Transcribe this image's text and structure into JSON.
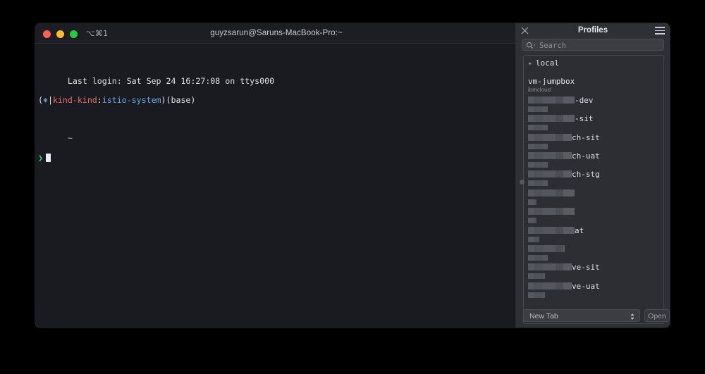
{
  "window": {
    "title": "guyzsarun@Saruns-MacBook-Pro:~",
    "shortcut": "⌥⌘1",
    "controls": {
      "close": "close-button",
      "minimize": "minimize-button",
      "maximize": "maximize-button"
    }
  },
  "terminal": {
    "last_login": "Last login: Sat Sep 24 16:27:08 on ttys000",
    "prompt_context": {
      "open_paren": "(",
      "helm_glyph": "⎈",
      "pipe": "|",
      "cluster": "kind-kind",
      "colon": ":",
      "namespace": "istio-system",
      "close_paren": ")",
      "conda_env": "(base)"
    },
    "cwd": "~",
    "prompt_char": "❯",
    "command": ""
  },
  "profiles_panel": {
    "title": "Profiles",
    "close_icon": "close-icon",
    "menu_icon": "hamburger-icon",
    "search": {
      "placeholder": "Search",
      "value": "",
      "icon": "search-icon"
    },
    "items": [
      {
        "name": "local",
        "starred": true,
        "star": "✶",
        "subtitle": "",
        "redacted": false
      },
      {
        "name": "vm-jumpbox",
        "starred": false,
        "subtitle": "ibmcloud",
        "redacted": false
      },
      {
        "name": "-dev",
        "starred": false,
        "subtitle": "",
        "redacted": true,
        "redact_width": 66,
        "sub_redact_width": 28
      },
      {
        "name": "-sit",
        "starred": false,
        "subtitle": "",
        "redacted": true,
        "redact_width": 66,
        "sub_redact_width": 28
      },
      {
        "name": "ch-sit",
        "starred": false,
        "subtitle": "",
        "redacted": true,
        "redact_width": 62,
        "sub_redact_width": 28
      },
      {
        "name": "ch-uat",
        "starred": false,
        "subtitle": "",
        "redacted": true,
        "redact_width": 62,
        "sub_redact_width": 28
      },
      {
        "name": "ch-stg",
        "starred": false,
        "subtitle": "",
        "redacted": true,
        "redact_width": 62,
        "sub_redact_width": 28
      },
      {
        "name": "",
        "starred": false,
        "subtitle": "",
        "redacted": true,
        "redact_width": 66,
        "sub_redact_width": 12
      },
      {
        "name": "",
        "starred": false,
        "subtitle": "",
        "redacted": true,
        "redact_width": 66,
        "sub_redact_width": 12
      },
      {
        "name": "at",
        "starred": false,
        "subtitle": "",
        "redacted": true,
        "redact_width": 66,
        "sub_redact_width": 16
      },
      {
        "name": "",
        "starred": false,
        "subtitle": "",
        "redacted": true,
        "redact_width": 52,
        "sub_redact_width": 28
      },
      {
        "name": "ve-sit",
        "starred": false,
        "subtitle": "",
        "redacted": true,
        "redact_width": 62,
        "sub_redact_width": 24
      },
      {
        "name": "ve-uat",
        "starred": false,
        "subtitle": "",
        "redacted": true,
        "redact_width": 62,
        "sub_redact_width": 24
      }
    ],
    "footer": {
      "action_select_value": "New Tab",
      "open_label": "Open"
    }
  },
  "colors": {
    "page_background": "#000000",
    "terminal_background": "#191b20",
    "panel_background": "#2e3035",
    "traffic_close": "#ff5f57",
    "traffic_min": "#febc2e",
    "traffic_max": "#28c840",
    "prompt_green": "#3fd36a",
    "cwd_cyan": "#5fd7e6",
    "cluster_red": "#ee6b6b",
    "namespace_blue": "#6fa8e8"
  }
}
